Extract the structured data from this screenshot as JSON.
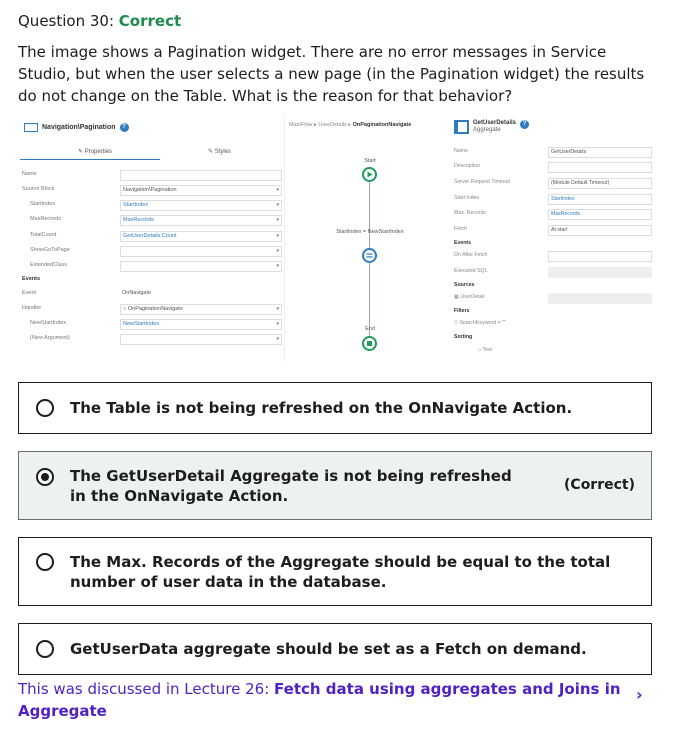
{
  "question": {
    "label": "Question 30:",
    "status": "Correct",
    "text": "The image shows a Pagination widget. There are no error messages in Service Studio, but when the user selects a new page (in the Pagination widget) the results do not change on the Table. What is the reason for that behavior?"
  },
  "figure": {
    "left_title": "Navigation\\Pagination",
    "tab_properties": "✎ Properties",
    "tab_styles": "✎ Styles",
    "props": [
      {
        "label": "Name",
        "value": ""
      },
      {
        "label": "Source Block",
        "value": "Navigation\\Pagination"
      },
      {
        "label": "StartIndex",
        "value": "StartIndex"
      },
      {
        "label": "MaxRecords",
        "value": "MaxRecords"
      },
      {
        "label": "TotalCount",
        "value": "GetUserDetails.Count"
      },
      {
        "label": "ShowGoToPage",
        "value": ""
      },
      {
        "label": "ExtendedClass",
        "value": ""
      }
    ],
    "events_label": "Events",
    "event_props": [
      {
        "label": "Event",
        "value": "OnNavigate"
      },
      {
        "label": "Handler",
        "value": "OnPaginationNavigate"
      },
      {
        "label": "NewStartIndex",
        "value": "NewStartIndex"
      },
      {
        "label": "(New Argument)",
        "value": ""
      }
    ],
    "flow_breadcrumb_1": "MainFlow ▸ UserDetails ▸ ",
    "flow_breadcrumb_2": "OnPaginationNavigate",
    "flow_start": "Start",
    "flow_assign": "StartIndex = NewStartIndex",
    "flow_end": "End",
    "right_title": "GetUserDetails",
    "right_subtitle": "Aggregate",
    "right_props": [
      {
        "label": "Name",
        "value": "GetUserDetails"
      },
      {
        "label": "Description",
        "value": ""
      },
      {
        "label": "Server Request Timeout",
        "value": "(Module Default Timeout)"
      },
      {
        "label": "Start Index",
        "value": "StartIndex"
      },
      {
        "label": "Max. Records",
        "value": "MaxRecords"
      },
      {
        "label": "Fetch",
        "value": "At start"
      }
    ],
    "right_events": "Events",
    "right_onafterfetch": "On After Fetch",
    "right_executed_sql": "Executed SQL",
    "right_sources": "Sources",
    "right_source_item": "UserDetail",
    "right_filters": "Filters",
    "right_filter_item": "SearchKeyword = \"\"",
    "right_sorting": "Sorting",
    "right_sort_item": "Test"
  },
  "options": [
    {
      "text": "The Table is not being refreshed on the OnNavigate Action."
    },
    {
      "text": "The GetUserDetail Aggregate is not being refreshed in the OnNavigate Action.",
      "tag": "(Correct)"
    },
    {
      "text": "The Max. Records of the Aggregate should be equal to the total number of user data in the database."
    },
    {
      "text": "GetUserData aggregate should be set as a Fetch on demand."
    }
  ],
  "footer": {
    "prefix": "This was discussed in Lecture 26: ",
    "link": "Fetch data using aggregates and Joins in Aggregate"
  }
}
